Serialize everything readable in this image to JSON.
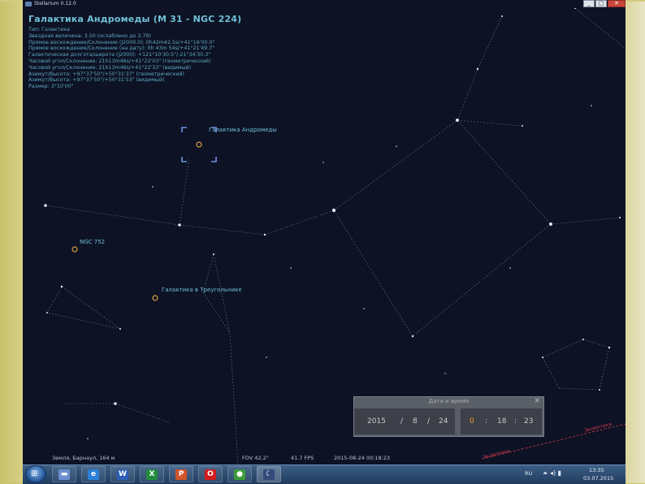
{
  "window": {
    "title": "Stellarium 0.12.0",
    "controls": [
      "_",
      "□",
      "✕"
    ]
  },
  "object": {
    "title": "Галактика Андромеды (M 31 - NGC 224)",
    "info": [
      "Тип: Галактика",
      "Звездная величина: 3.50 (ослаблено до 3.79)",
      "Прямое восхождение/Склонение (J2000.0): 0h42m42.5s/+41°16'00.0\"",
      "Прямое восхождение/Склонение (на дату): 0h 43m 54s/+41°21'49.7\"",
      "Галактическая долгота/широта (J2000): +121°10'30.5\"/-21°34'30.3\"",
      "Часовой угол/Склонение: 21h13m46s/+41°22'03\" (геометрический)",
      "Часовой угол/Склонение: 21h13m46s/+41°22'33\" (видимый)",
      "Азимут/Высота: +97°37'50\"/+50°31'37\" (геометрический)",
      "Азимут/Высота: +97°37'50\"/+50°31'53\" (видимый)",
      "Размер: 3°10'00\""
    ]
  },
  "sky_labels": {
    "andromeda": "Галактика Андромеды",
    "ngc752": "NGC 752",
    "triangulum": "Галактика в Треугольнике",
    "horizon1": "Эклиптика",
    "horizon2": "Эклиптика"
  },
  "date_dialog": {
    "title": "Дата и время",
    "close": "✕",
    "year": "2015",
    "month": "8",
    "day": "24",
    "hour": "0",
    "minute": "18",
    "second": "23",
    "date_sep": "/",
    "time_sep": ":"
  },
  "status": {
    "location": "Земля, Барнаул, 164 м",
    "fov": "FOV 42.2°",
    "fps": "41.7 FPS",
    "datetime": "2015-08-24    00:18:23"
  },
  "taskbar": {
    "start_glyph": "⊞",
    "apps": [
      {
        "name": "file-manager",
        "glyph": "▬",
        "color": "#6b8fd0"
      },
      {
        "name": "internet-explorer",
        "glyph": "e",
        "color": "#2a7fd6"
      },
      {
        "name": "word",
        "glyph": "W",
        "color": "#2b5fb5"
      },
      {
        "name": "excel",
        "glyph": "X",
        "color": "#1f8b3b"
      },
      {
        "name": "powerpoint",
        "glyph": "P",
        "color": "#d2542b"
      },
      {
        "name": "opera",
        "glyph": "O",
        "color": "#d31b1b"
      },
      {
        "name": "chrome",
        "glyph": "●",
        "color": "#3a9d3a"
      },
      {
        "name": "stellarium",
        "glyph": "☾",
        "color": "#344a7a"
      }
    ],
    "lang": "RU",
    "time": "13:35",
    "date": "03.07.2015"
  },
  "colors": {
    "sky": "#0d1225",
    "constellation": "#6d86a8",
    "label": "#6fc0d6",
    "marker": "#e0a040",
    "horizon": "#d23b4a"
  }
}
